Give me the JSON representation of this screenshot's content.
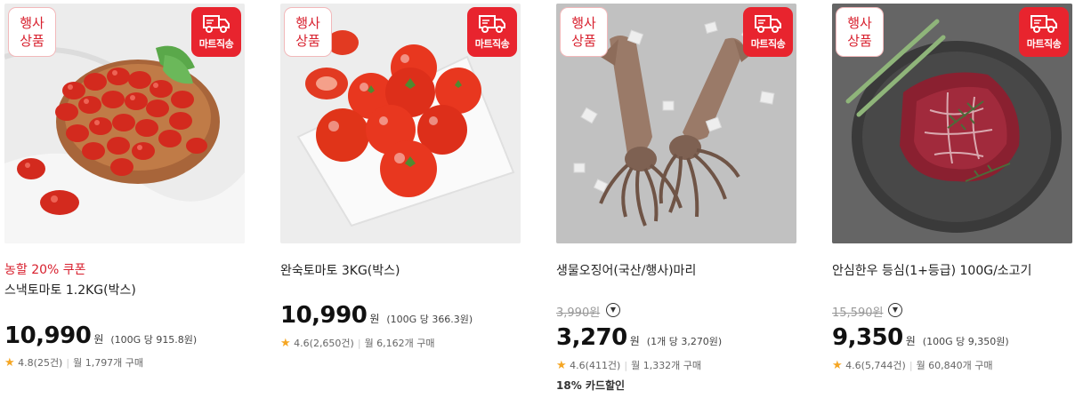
{
  "products": [
    {
      "promo": "농할 20% 쿠폰",
      "name": "스낵토마토 1.2KG(박스)",
      "original_price": "",
      "price": "10,990",
      "won": "원",
      "unit_price": "(100G 당 915.8원)",
      "rating": "4.8(25건)",
      "monthly": "월 1,797개 구매",
      "card_discount": "",
      "badge_event": [
        "행사",
        "상품"
      ],
      "badge_mart": "마트직송"
    },
    {
      "promo": "",
      "name": "완숙토마토 3KG(박스)",
      "original_price": "",
      "price": "10,990",
      "won": "원",
      "unit_price": "(100G 당 366.3원)",
      "rating": "4.6(2,650건)",
      "monthly": "월 6,162개 구매",
      "card_discount": "",
      "badge_event": [
        "행사",
        "상품"
      ],
      "badge_mart": "마트직송"
    },
    {
      "promo": "",
      "name": "생물오징어(국산/행사)마리",
      "original_price": "3,990원",
      "price": "3,270",
      "won": "원",
      "unit_price": "(1개 당 3,270원)",
      "rating": "4.6(411건)",
      "monthly": "월 1,332개 구매",
      "card_discount": "18% 카드할인",
      "badge_event": [
        "행사",
        "상품"
      ],
      "badge_mart": "마트직송"
    },
    {
      "promo": "",
      "name": "안심한우 등심(1+등급) 100G/소고기",
      "original_price": "15,590원",
      "price": "9,350",
      "won": "원",
      "unit_price": "(100G 당 9,350원)",
      "rating": "4.6(5,744건)",
      "monthly": "월 60,840개 구매",
      "card_discount": "",
      "badge_event": [
        "행사",
        "상품"
      ],
      "badge_mart": "마트직송"
    }
  ],
  "icons": {
    "truck": "truck-icon",
    "star": "star-icon",
    "info": "chevron-down-icon"
  },
  "colors": {
    "accent_red": "#e8242e",
    "promo_red": "#d8202e",
    "star": "#f5a623"
  }
}
